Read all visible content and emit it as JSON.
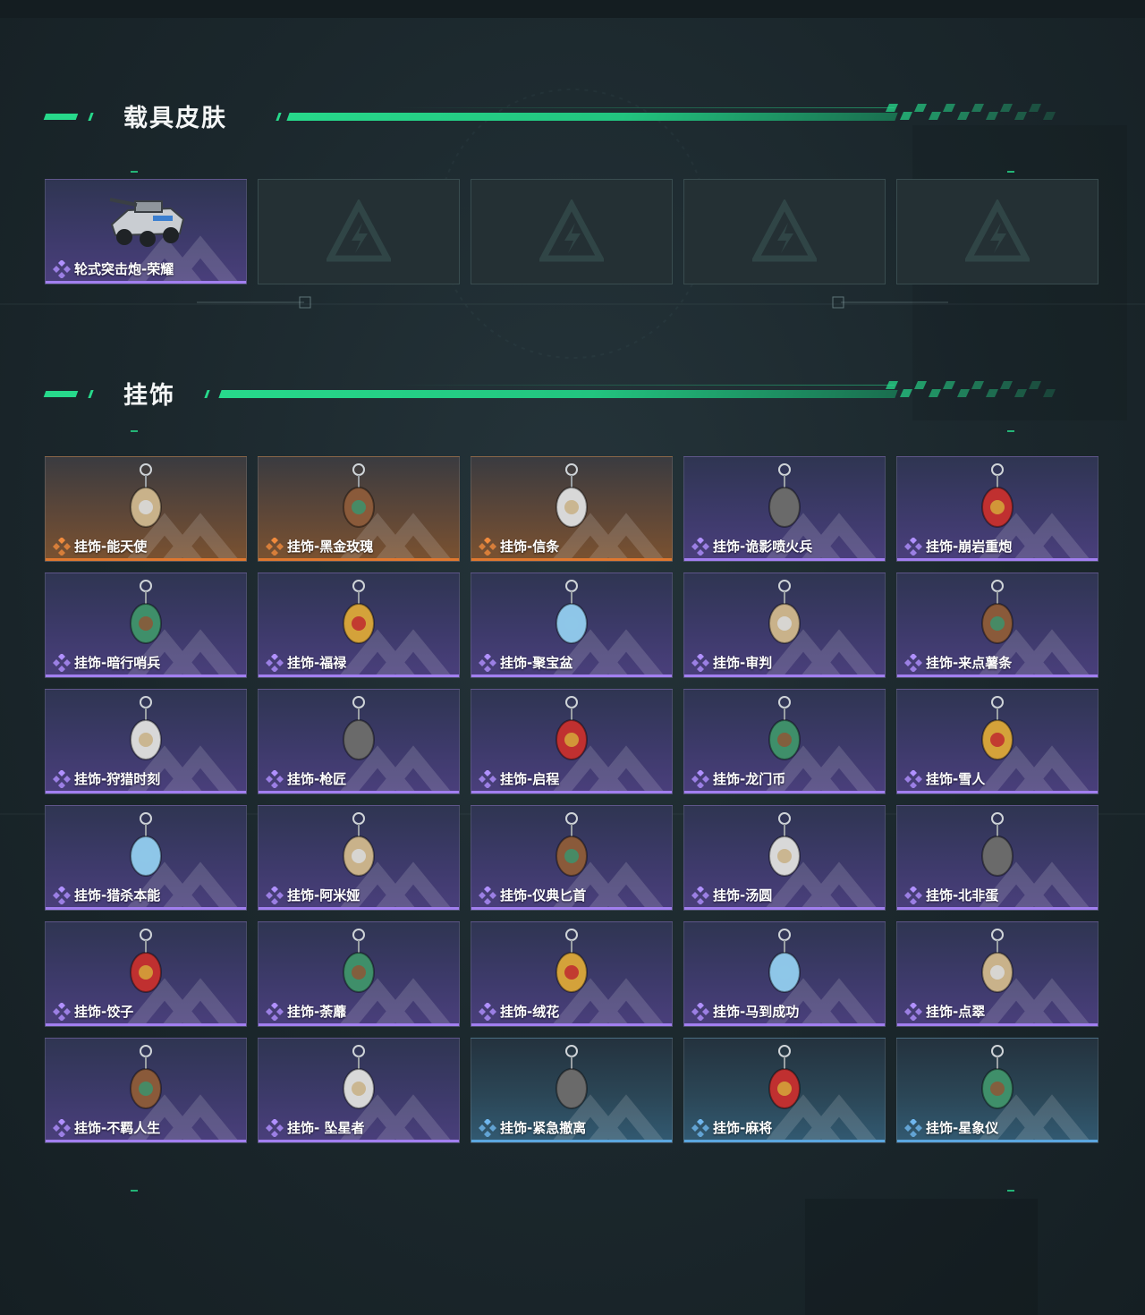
{
  "vehicle_section": {
    "title": "载具皮肤",
    "items": [
      {
        "label": "轮式突击炮-荣耀",
        "rarity": "purple"
      },
      {
        "label": "",
        "rarity": "empty"
      },
      {
        "label": "",
        "rarity": "empty"
      },
      {
        "label": "",
        "rarity": "empty"
      },
      {
        "label": "",
        "rarity": "empty"
      }
    ]
  },
  "charm_section": {
    "title": "挂饰",
    "items": [
      {
        "label": "挂饰-能天使",
        "rarity": "orange"
      },
      {
        "label": "挂饰-黑金玫瑰",
        "rarity": "orange"
      },
      {
        "label": "挂饰-信条",
        "rarity": "orange"
      },
      {
        "label": "挂饰-诡影喷火兵",
        "rarity": "purple"
      },
      {
        "label": "挂饰-崩岩重炮",
        "rarity": "purple"
      },
      {
        "label": "挂饰-暗行哨兵",
        "rarity": "purple"
      },
      {
        "label": "挂饰-福禄",
        "rarity": "purple"
      },
      {
        "label": "挂饰-聚宝盆",
        "rarity": "purple"
      },
      {
        "label": "挂饰-审判",
        "rarity": "purple"
      },
      {
        "label": "挂饰-来点薯条",
        "rarity": "purple"
      },
      {
        "label": "挂饰-狩猎时刻",
        "rarity": "purple"
      },
      {
        "label": "挂饰-枪匠",
        "rarity": "purple"
      },
      {
        "label": "挂饰-启程",
        "rarity": "purple"
      },
      {
        "label": "挂饰-龙门币",
        "rarity": "purple"
      },
      {
        "label": "挂饰-雪人",
        "rarity": "purple"
      },
      {
        "label": "挂饰-猎杀本能",
        "rarity": "purple"
      },
      {
        "label": "挂饰-阿米娅",
        "rarity": "purple"
      },
      {
        "label": "挂饰-仪典匕首",
        "rarity": "purple"
      },
      {
        "label": "挂饰-汤圆",
        "rarity": "purple"
      },
      {
        "label": "挂饰-北非蛋",
        "rarity": "purple"
      },
      {
        "label": "挂饰-饺子",
        "rarity": "purple"
      },
      {
        "label": "挂饰-荼蘼",
        "rarity": "purple"
      },
      {
        "label": "挂饰-绒花",
        "rarity": "purple"
      },
      {
        "label": "挂饰-马到成功",
        "rarity": "purple"
      },
      {
        "label": "挂饰-点翠",
        "rarity": "purple"
      },
      {
        "label": "挂饰-不羁人生",
        "rarity": "purple"
      },
      {
        "label": "挂饰- 坠星者",
        "rarity": "purple"
      },
      {
        "label": "挂饰-紧急撤离",
        "rarity": "blue"
      },
      {
        "label": "挂饰-麻将",
        "rarity": "blue"
      },
      {
        "label": "挂饰-星象仪",
        "rarity": "blue"
      }
    ]
  },
  "colors": {
    "accent_green": "#27d98b",
    "rarity_orange": "#e0782f",
    "rarity_purple": "#a27ff0",
    "rarity_blue": "#5ba7e0"
  },
  "icons": {
    "rarity": "diamond-cluster-icon",
    "empty_slot": "triangle-logo-icon"
  }
}
